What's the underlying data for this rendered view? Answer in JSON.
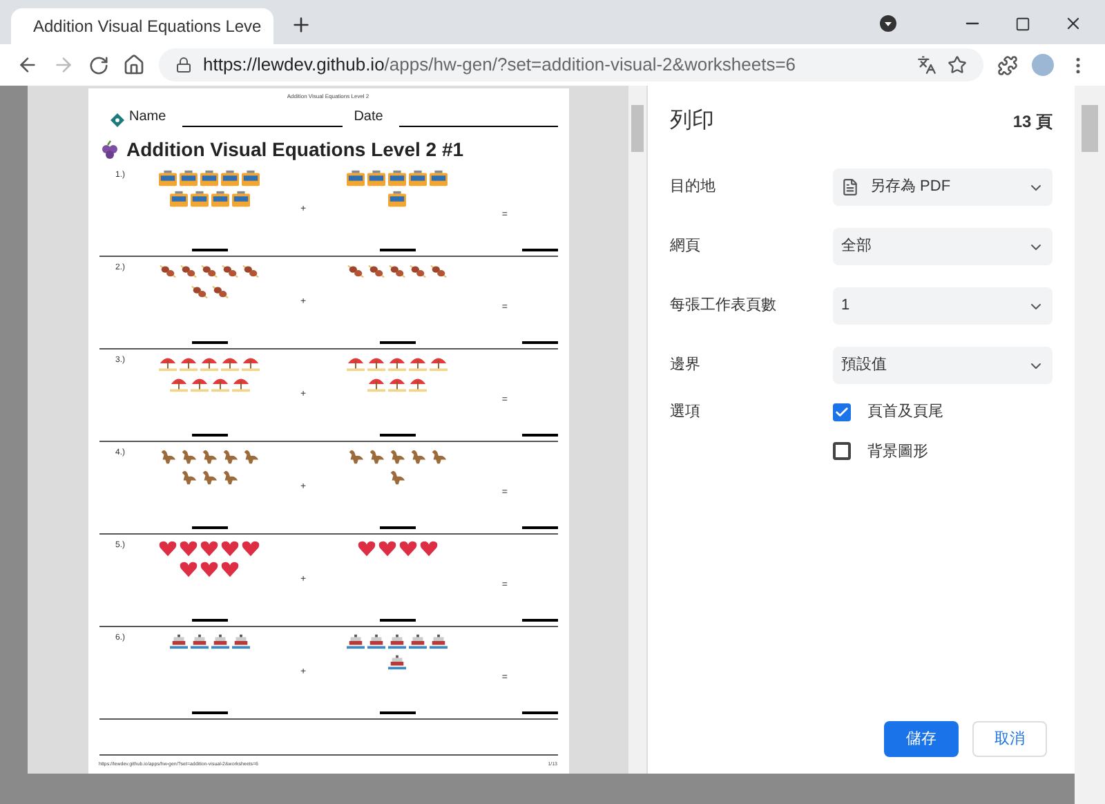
{
  "tab": {
    "title": "Addition Visual Equations Leve"
  },
  "address": {
    "prefix": "https://",
    "host": "lewdev.github.io",
    "path": "/apps/hw-gen/?set=addition-visual-2&worksheets=6"
  },
  "worksheet": {
    "header": "Addition Visual Equations Level 2",
    "name_label": "Name",
    "date_label": "Date",
    "title": "Addition Visual Equations Level 2 #1",
    "problems": [
      {
        "number": "1.)",
        "plus": "+",
        "equals": "=",
        "left": [
          {
            "kind": "tram"
          },
          {
            "kind": "tram"
          },
          {
            "kind": "tram"
          },
          {
            "kind": "tram"
          },
          {
            "kind": "tram"
          },
          {
            "kind": "tram"
          },
          {
            "kind": "tram"
          },
          {
            "kind": "tram"
          },
          {
            "kind": "tram"
          }
        ],
        "right": [
          {
            "kind": "tram"
          },
          {
            "kind": "tram"
          },
          {
            "kind": "tram"
          },
          {
            "kind": "tram"
          },
          {
            "kind": "tram"
          },
          {
            "kind": "tram"
          }
        ]
      },
      {
        "number": "2.)",
        "plus": "+",
        "equals": "=",
        "left": [
          {
            "kind": "skewer"
          },
          {
            "kind": "skewer"
          },
          {
            "kind": "skewer"
          },
          {
            "kind": "skewer"
          },
          {
            "kind": "skewer"
          },
          {
            "kind": "skewer"
          },
          {
            "kind": "skewer"
          }
        ],
        "right": [
          {
            "kind": "skewer"
          },
          {
            "kind": "skewer"
          },
          {
            "kind": "skewer"
          },
          {
            "kind": "skewer"
          },
          {
            "kind": "skewer"
          }
        ]
      },
      {
        "number": "3.)",
        "plus": "+",
        "equals": "=",
        "left": [
          {
            "kind": "umbrella"
          },
          {
            "kind": "umbrella"
          },
          {
            "kind": "umbrella"
          },
          {
            "kind": "umbrella"
          },
          {
            "kind": "umbrella"
          },
          {
            "kind": "umbrella"
          },
          {
            "kind": "umbrella"
          },
          {
            "kind": "umbrella"
          },
          {
            "kind": "umbrella"
          }
        ],
        "right": [
          {
            "kind": "umbrella"
          },
          {
            "kind": "umbrella"
          },
          {
            "kind": "umbrella"
          },
          {
            "kind": "umbrella"
          },
          {
            "kind": "umbrella"
          },
          {
            "kind": "umbrella"
          },
          {
            "kind": "umbrella"
          },
          {
            "kind": "umbrella"
          }
        ]
      },
      {
        "number": "4.)",
        "plus": "+",
        "equals": "=",
        "left": [
          {
            "kind": "dino"
          },
          {
            "kind": "dino"
          },
          {
            "kind": "dino"
          },
          {
            "kind": "dino"
          },
          {
            "kind": "dino"
          },
          {
            "kind": "dino"
          },
          {
            "kind": "dino"
          },
          {
            "kind": "dino"
          }
        ],
        "right": [
          {
            "kind": "dino"
          },
          {
            "kind": "dino"
          },
          {
            "kind": "dino"
          },
          {
            "kind": "dino"
          },
          {
            "kind": "dino"
          },
          {
            "kind": "dino"
          }
        ]
      },
      {
        "number": "5.)",
        "plus": "+",
        "equals": "=",
        "left": [
          {
            "kind": "heart"
          },
          {
            "kind": "heart"
          },
          {
            "kind": "heart"
          },
          {
            "kind": "heart"
          },
          {
            "kind": "heart"
          },
          {
            "kind": "heart"
          },
          {
            "kind": "heart"
          },
          {
            "kind": "heart"
          }
        ],
        "right": [
          {
            "kind": "heart"
          },
          {
            "kind": "heart"
          },
          {
            "kind": "heart"
          },
          {
            "kind": "heart"
          }
        ]
      },
      {
        "number": "6.)",
        "plus": "+",
        "equals": "=",
        "left": [
          {
            "kind": "ship"
          },
          {
            "kind": "ship"
          },
          {
            "kind": "ship"
          },
          {
            "kind": "ship"
          }
        ],
        "right": [
          {
            "kind": "ship"
          },
          {
            "kind": "ship"
          },
          {
            "kind": "ship"
          },
          {
            "kind": "ship"
          },
          {
            "kind": "ship"
          },
          {
            "kind": "ship"
          }
        ]
      }
    ],
    "footer_url": "https://lewdev.github.io/apps/hw-gen/?set=addition-visual-2&worksheets=6",
    "footer_page": "1/13"
  },
  "print": {
    "title": "列印",
    "page_count": "13 頁",
    "settings": [
      {
        "label": "目的地",
        "value": "另存為 PDF",
        "file_icon": true
      },
      {
        "label": "網頁",
        "value": "全部",
        "file_icon": false
      },
      {
        "label": "每張工作表頁數",
        "value": "1",
        "file_icon": false
      },
      {
        "label": "邊界",
        "value": "預設值",
        "file_icon": false
      }
    ],
    "options_label": "選項",
    "options": [
      {
        "label": "頁首及頁尾",
        "checked": true
      },
      {
        "label": "背景圖形",
        "checked": false
      }
    ],
    "save": "儲存",
    "cancel": "取消"
  }
}
